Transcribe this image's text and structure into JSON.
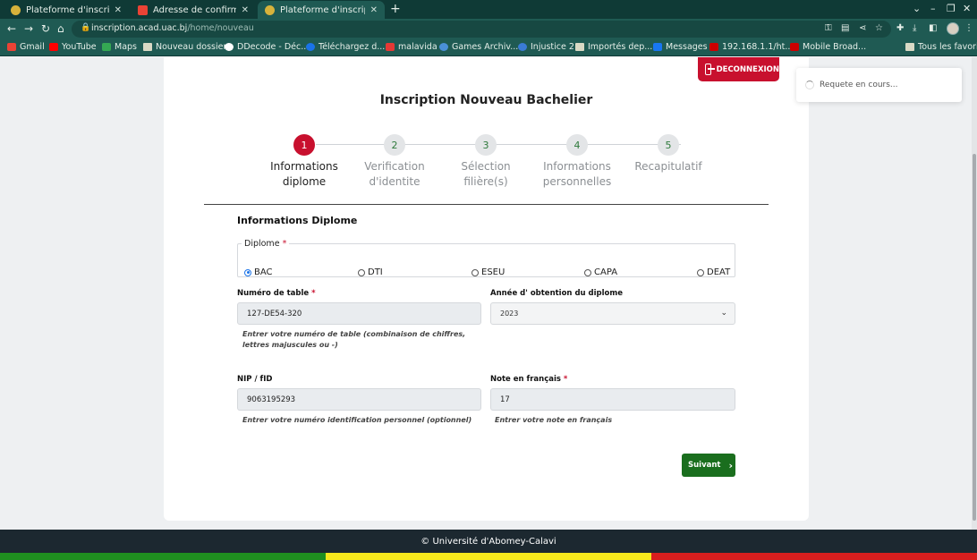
{
  "browser": {
    "tabs": [
      {
        "title": "Plateforme d'inscription",
        "favicon_color": "#d7b23b",
        "active": false
      },
      {
        "title": "Adresse de confirmation",
        "favicon_color": "#ea4335",
        "active": false
      },
      {
        "title": "Plateforme d'inscription",
        "favicon_color": "#d7b23b",
        "active": true
      }
    ],
    "new_tab": "+",
    "url_host": "inscription.acad.uac.bj",
    "url_path": "/home/nouveau",
    "bookmarks": [
      {
        "label": "Gmail",
        "color": "#ea4335"
      },
      {
        "label": "YouTube",
        "color": "#ff0000"
      },
      {
        "label": "Maps",
        "color": "#34a853"
      },
      {
        "label": "Nouveau dossier",
        "color": "#d9d9c5"
      },
      {
        "label": "DDecode - Déc...",
        "color": "#ffffff"
      },
      {
        "label": "Téléchargez d...",
        "color": "#1a73e8"
      },
      {
        "label": "malavida",
        "color": "#e53935"
      },
      {
        "label": "Games Archiv...",
        "color": "#4a90d9"
      },
      {
        "label": "Injustice 2",
        "color": "#3a7bd5"
      },
      {
        "label": "Importés dep...",
        "color": "#d9d9c5"
      },
      {
        "label": "Messages",
        "color": "#1877f2"
      },
      {
        "label": "192.168.1.1/ht...",
        "color": "#cc0000"
      },
      {
        "label": "Mobile Broad...",
        "color": "#cc0000"
      },
      {
        "label": "Tous les favoris",
        "color": "#d9d9c5"
      }
    ]
  },
  "header": {
    "logout_label": "DECONNEXION",
    "title": "Inscription Nouveau Bachelier"
  },
  "stepper": [
    {
      "num": "1",
      "label_line1": "Informations",
      "label_line2": "diplome",
      "active": true
    },
    {
      "num": "2",
      "label_line1": "Verification",
      "label_line2": "d'identite",
      "active": false
    },
    {
      "num": "3",
      "label_line1": "Sélection",
      "label_line2": "filière(s)",
      "active": false
    },
    {
      "num": "4",
      "label_line1": "Informations",
      "label_line2": "personnelles",
      "active": false
    },
    {
      "num": "5",
      "label_line1": "Recapitulatif",
      "label_line2": "",
      "active": false
    }
  ],
  "form": {
    "section_title": "Informations Diplome",
    "diploma": {
      "legend": "Diplome",
      "required_mark": "*",
      "options": [
        "BAC",
        "DTI",
        "ESEU",
        "CAPA",
        "DEAT"
      ],
      "selected": "BAC"
    },
    "table_number": {
      "label": "Numéro de table",
      "required_mark": "*",
      "value": "127-DE54-320",
      "help": "Entrer votre numéro de table (combinaison de chiffres, lettres majuscules ou -)"
    },
    "year": {
      "label": "Année d' obtention du diplome",
      "value": "2023"
    },
    "nip": {
      "label": "NIP / fID",
      "value": "9063195293",
      "help": "Entrer votre numéro identification personnel (optionnel)"
    },
    "french_grade": {
      "label": "Note en français",
      "required_mark": "*",
      "value": "17",
      "help": "Entrer votre note en français"
    },
    "next_label": "Suivant"
  },
  "toast": {
    "text": "Requete en cours..."
  },
  "footer": {
    "text": "© Université d'Abomey-Calavi",
    "flag_colors": [
      "#1f8f1f",
      "#f6e81c",
      "#d81e1e"
    ]
  },
  "colors": {
    "brand_red": "#c8102e",
    "brand_green": "#1a6e1e",
    "chrome_dark": "#0f3a36",
    "chrome": "#1f5a53"
  }
}
